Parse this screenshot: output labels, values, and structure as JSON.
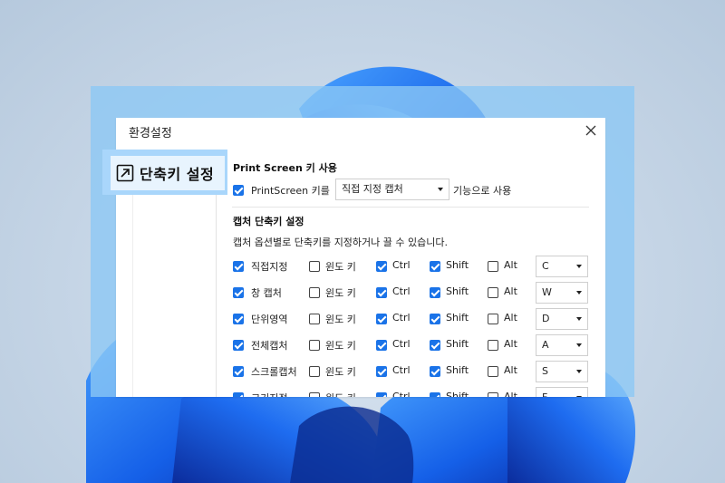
{
  "dialog": {
    "title": "환경설정"
  },
  "sidebar": {
    "active_tab_label": "단축키 설정"
  },
  "printscreen": {
    "section_title": "Print Screen 키 사용",
    "checkbox_label": "PrintScreen 키를",
    "checked": true,
    "dropdown_value": "직접 지정 캡처",
    "suffix": "기능으로 사용"
  },
  "shortcuts": {
    "section_title": "캡처 단축키 설정",
    "description": "캡처 옵션별로 단축키를 지정하거나 끌 수 있습니다.",
    "modifier_labels": {
      "win": "윈도 키",
      "ctrl": "Ctrl",
      "shift": "Shift",
      "alt": "Alt"
    },
    "rows": [
      {
        "name": "직접지정",
        "enabled": true,
        "win": false,
        "ctrl": true,
        "shift": true,
        "alt": false,
        "key": "C"
      },
      {
        "name": "창 캡처",
        "enabled": true,
        "win": false,
        "ctrl": true,
        "shift": true,
        "alt": false,
        "key": "W"
      },
      {
        "name": "단위영역",
        "enabled": true,
        "win": false,
        "ctrl": true,
        "shift": true,
        "alt": false,
        "key": "D"
      },
      {
        "name": "전체캡처",
        "enabled": true,
        "win": false,
        "ctrl": true,
        "shift": true,
        "alt": false,
        "key": "A"
      },
      {
        "name": "스크롤캡처",
        "enabled": true,
        "win": false,
        "ctrl": true,
        "shift": true,
        "alt": false,
        "key": "S"
      },
      {
        "name": "크기지정",
        "enabled": true,
        "win": false,
        "ctrl": true,
        "shift": true,
        "alt": false,
        "key": "F"
      }
    ]
  },
  "colors": {
    "accent": "#1a73e8",
    "highlight": "#8cc8f5",
    "tab_background": "#e8f4fe"
  }
}
